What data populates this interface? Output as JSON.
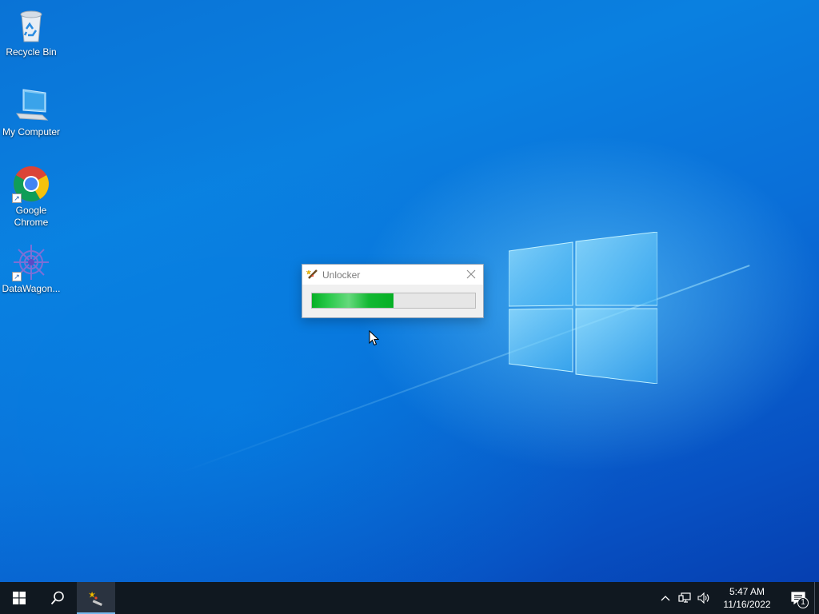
{
  "desktop": {
    "icons": [
      {
        "label": "Recycle Bin",
        "icon": "recycle-bin-icon"
      },
      {
        "label": "My Computer",
        "icon": "computer-icon"
      },
      {
        "label": "Google Chrome",
        "icon": "chrome-icon"
      },
      {
        "label": "DataWagon...",
        "icon": "datawagon-icon"
      }
    ]
  },
  "dialog": {
    "title": "Unlocker",
    "icon": "magic-wand-icon",
    "progress": 0.5,
    "progress_color": "#06b025"
  },
  "taskbar": {
    "start_icon": "windows-start-icon",
    "search_icon": "search-icon",
    "active_app_icon": "magic-wand-icon",
    "tray": {
      "chevron_icon": "chevron-up-icon",
      "network_icon": "network-icon",
      "volume_icon": "volume-icon",
      "time": "5:47 AM",
      "date": "11/16/2022",
      "notification_count": "1"
    }
  },
  "colors": {
    "taskbar": "#101820",
    "desktop_accent": "#0a73d6"
  }
}
